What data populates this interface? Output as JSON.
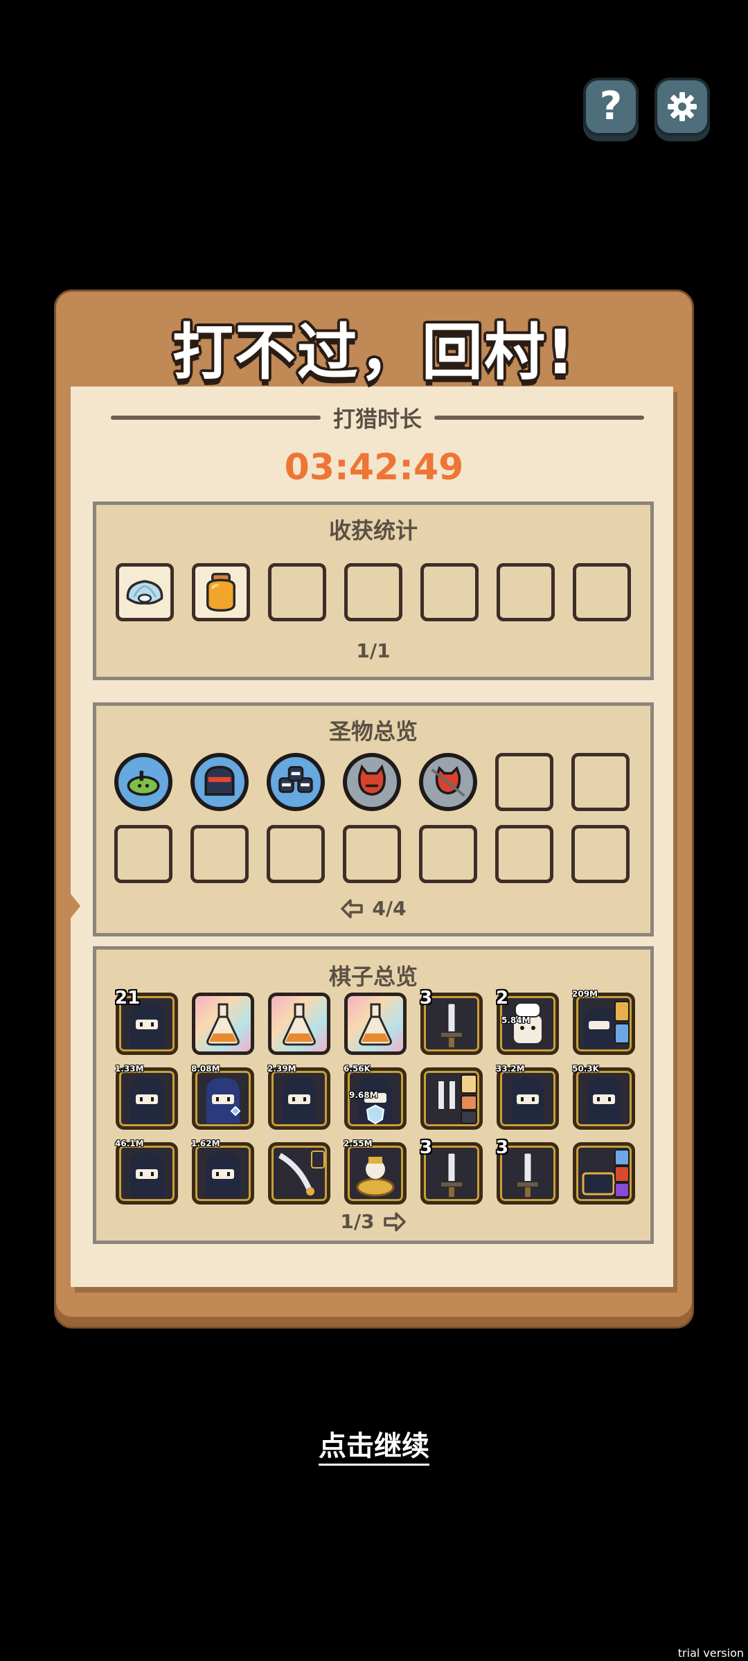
{
  "title": "打不过，回村!",
  "duration": {
    "label": "打猎时长",
    "value": "03:42:49"
  },
  "harvest": {
    "title": "收获统计",
    "items": [
      "shell-icon",
      "honey-jar-icon",
      "",
      "",
      "",
      "",
      ""
    ],
    "page": "1/1"
  },
  "relics": {
    "title": "圣物总览",
    "items": [
      "green-submarine-relic-icon",
      "ninja-mask-relic-icon",
      "ninja-trio-relic-icon",
      "red-demon-relic-icon",
      "red-demon-cracked-relic-icon",
      "",
      "",
      "",
      "",
      "",
      "",
      "",
      "",
      ""
    ],
    "page": "4/4"
  },
  "pieces": {
    "title": "棋子总览",
    "cards": [
      {
        "kind": "ninja",
        "badge": "21",
        "big": true
      },
      {
        "kind": "flask",
        "badge": ""
      },
      {
        "kind": "flask",
        "badge": ""
      },
      {
        "kind": "flask",
        "badge": ""
      },
      {
        "kind": "sword",
        "badge": "3",
        "big": true
      },
      {
        "kind": "chef",
        "badge": "2",
        "big": true,
        "sub": "5.84M"
      },
      {
        "kind": "ninja-cards",
        "badge": "209M"
      },
      {
        "kind": "ninja",
        "badge": "1.33M"
      },
      {
        "kind": "ninja-blue",
        "badge": "8.08M"
      },
      {
        "kind": "ninja",
        "badge": "2.39M"
      },
      {
        "kind": "ninja-shield",
        "badge": "6.56K",
        "sub": "9.68M"
      },
      {
        "kind": "sword-cards",
        "badge": ""
      },
      {
        "kind": "ninja",
        "badge": "33.2M"
      },
      {
        "kind": "ninja",
        "badge": "50.3K"
      },
      {
        "kind": "ninja",
        "badge": "46.1M"
      },
      {
        "kind": "ninja",
        "badge": "1.62M"
      },
      {
        "kind": "blade",
        "badge": ""
      },
      {
        "kind": "gold-pile",
        "badge": "2.55M"
      },
      {
        "kind": "sword",
        "badge": "3",
        "big": true
      },
      {
        "kind": "sword",
        "badge": "3",
        "big": true
      },
      {
        "kind": "chest",
        "badge": ""
      }
    ],
    "page": "1/3"
  },
  "continue_label": "点击继续",
  "watermark": "trial version",
  "colors": {
    "timer": "#ee7535",
    "board": "#c08955",
    "paper": "#f3e6cd",
    "panel": "#e6d3ac"
  }
}
